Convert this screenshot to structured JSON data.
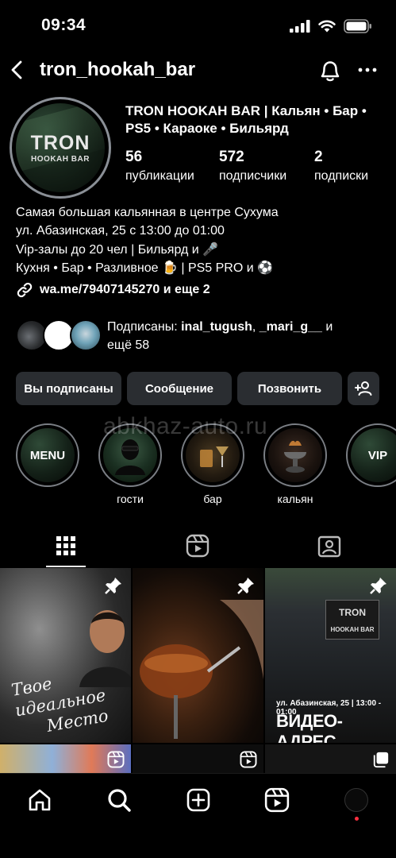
{
  "status": {
    "time": "09:34"
  },
  "nav": {
    "username": "tron_hookah_bar"
  },
  "avatar": {
    "logo_main": "TRON",
    "logo_sub": "HOOKAH BAR"
  },
  "profile": {
    "name": "TRON HOOKAH BAR | Кальян • Бар • PS5 • Караоке • Бильярд",
    "stats": [
      {
        "num": "56",
        "label": "публикации"
      },
      {
        "num": "572",
        "label": "подписчики"
      },
      {
        "num": "2",
        "label": "подписки"
      }
    ]
  },
  "bio": {
    "lines": [
      "Самая большая кальянная в центре Сухума",
      "ул. Абазинская, 25 с 13:00 до 01:00",
      "Vip-залы до 20 чел | Бильярд и 🎤",
      "Кухня • Бар • Разливное 🍺 | PS5 PRO и ⚽"
    ],
    "link": "wa.me/79407145270 и еще 2"
  },
  "followed_by": {
    "prefix": "Подписаны: ",
    "user1": "inal_tugush",
    "sep": ", ",
    "user2": "_mari_g__",
    "suffix": " и",
    "more": "ещё 58"
  },
  "buttons": {
    "subscribed": "Вы подписаны",
    "message": "Сообщение",
    "call": "Позвонить"
  },
  "highlights": [
    {
      "inner": "MENU",
      "label": ""
    },
    {
      "inner": "",
      "label": "гости"
    },
    {
      "inner": "",
      "label": "бар"
    },
    {
      "inner": "",
      "label": "кальян"
    },
    {
      "inner": "VIP",
      "label": ""
    }
  ],
  "watermark": "abkhaz-auto.ru",
  "posts": {
    "post1_text_1": "Твое идеальное",
    "post1_text_2": "Место",
    "post3_sign_1": "TRON",
    "post3_sign_2": "HOOKAH BAR",
    "post3_caption": "ул. Абазинская, 25 | 13:00 - 01:00",
    "post3_title": "ВИДЕО-АДРЕС"
  },
  "colors": {
    "background": "#000000",
    "button": "#2a2d31",
    "ring": "#7a7e84",
    "notification": "#ff3040"
  }
}
